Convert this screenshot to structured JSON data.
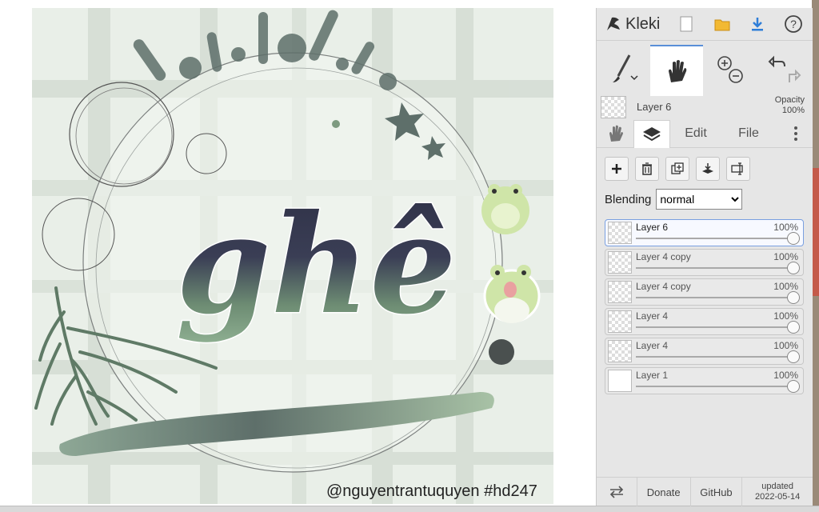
{
  "app": {
    "name": "Kleki"
  },
  "artwork": {
    "title_text": "ghê",
    "watermark": "@nguyentrantuquyen  #hd247"
  },
  "toolbar": {
    "tools": [
      "brush-tool",
      "hand-tool",
      "zoom-tool",
      "undo-redo"
    ]
  },
  "current_layer": {
    "name": "Layer 6",
    "opacity_label": "Opacity",
    "opacity_value": "100%"
  },
  "tabs": {
    "edit": "Edit",
    "file": "File"
  },
  "blending": {
    "label": "Blending",
    "value": "normal"
  },
  "layers": [
    {
      "name": "Layer 6",
      "opacity": "100%"
    },
    {
      "name": "Layer 4 copy",
      "opacity": "100%"
    },
    {
      "name": "Layer 4 copy",
      "opacity": "100%"
    },
    {
      "name": "Layer 4",
      "opacity": "100%"
    },
    {
      "name": "Layer 4",
      "opacity": "100%"
    },
    {
      "name": "Layer 1",
      "opacity": "100%"
    }
  ],
  "footer": {
    "donate": "Donate",
    "github": "GitHub",
    "updated_label": "updated",
    "updated_date": "2022-05-14"
  },
  "colors": {
    "accent": "#5a8fd8",
    "panel_bg": "#e6e6e6",
    "art_bg": "#e9efe8",
    "ink": "#2f2f45",
    "sage": "#7d9a80"
  }
}
